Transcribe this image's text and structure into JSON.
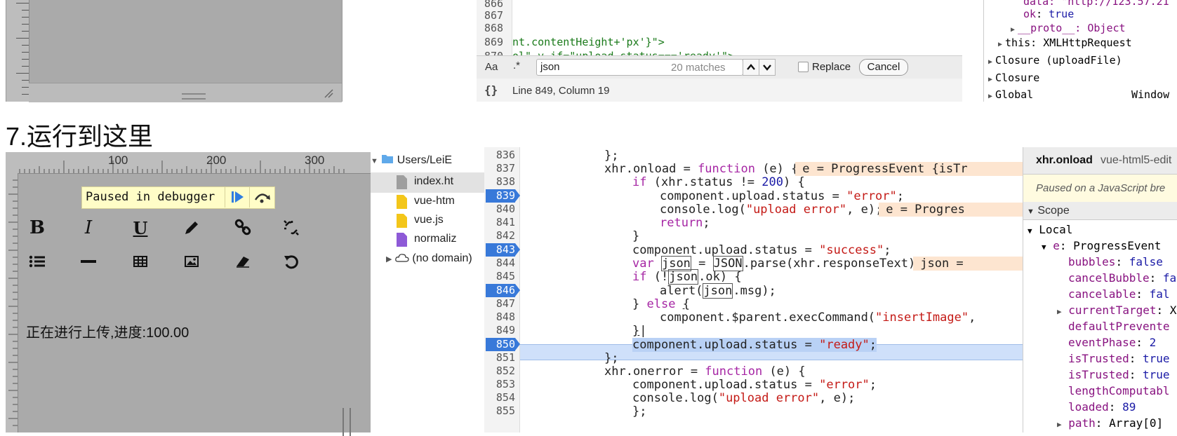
{
  "top_strip": {
    "code_line_numbers": [
      "866",
      "867",
      "868",
      "869",
      "870"
    ],
    "code_line_869": "nt.contentHeight+'px'}\">",
    "code_line_870_partial": "ol\" v-if=\"upload.status==='ready'\">",
    "find_bar": {
      "case_toggle": "Aa",
      "regex_toggle": ".*",
      "query": "json",
      "matches": "20 matches",
      "replace_label": "Replace",
      "cancel_label": "Cancel"
    },
    "status": {
      "braces": "{}",
      "position": "Line 849, Column 19"
    },
    "scope": {
      "data_line": "data: \"http://123.57.21",
      "ok_key": "ok",
      "ok_value": "true",
      "proto": "__proto__: Object",
      "this": "this: XMLHttpRequest",
      "closure_upload": "Closure (uploadFile)",
      "closure": "Closure",
      "global": "Global",
      "global_value": "Window"
    }
  },
  "heading": "7.运行到这里",
  "editor": {
    "ruler_labels": [
      "100",
      "200",
      "300"
    ],
    "paused_label": "Paused in debugger",
    "upload_status_text": "正在进行上传,进度:100.00",
    "toolbar_row1": [
      "bold-icon",
      "italic-icon",
      "underline-icon",
      "pencil-icon",
      "link-icon",
      "unlink-icon"
    ],
    "toolbar_row2": [
      "list-icon",
      "hr-icon",
      "table-icon",
      "image-icon",
      "eraser-icon",
      "undo-icon"
    ]
  },
  "sources": {
    "folder": "Users/LeiE",
    "files": [
      "index.ht",
      "vue-htm",
      "vue.js",
      "normaliz"
    ],
    "no_domain": "(no domain)"
  },
  "code": {
    "line_numbers": [
      "836",
      "837",
      "838",
      "839",
      "840",
      "841",
      "842",
      "843",
      "844",
      "845",
      "846",
      "847",
      "848",
      "849",
      "850",
      "851",
      "852",
      "853",
      "854",
      "855"
    ],
    "breakpoints": [
      "839",
      "843",
      "846",
      "850"
    ],
    "current_line": "850"
  },
  "scope_panel": {
    "header_title": "xhr.onload",
    "header_file": "vue-html5-edit",
    "paused_msg": "Paused on a JavaScript bre",
    "scope_title": "Scope",
    "local": "Local",
    "event_key": "e",
    "event_value": "ProgressEvent",
    "props": [
      {
        "k": "bubbles",
        "v": "false",
        "expand": false
      },
      {
        "k": "cancelBubble",
        "v": "fa",
        "expand": false
      },
      {
        "k": "cancelable",
        "v": "fal",
        "expand": false
      },
      {
        "k": "currentTarget",
        "v": "X",
        "expand": true
      },
      {
        "k": "defaultPrevente",
        "v": "",
        "expand": false
      },
      {
        "k": "eventPhase",
        "v": "2",
        "expand": false
      },
      {
        "k": "isTrusted",
        "v": "true",
        "expand": false
      },
      {
        "k": "isTrusted",
        "v": "true",
        "expand": false
      },
      {
        "k": "lengthComputabl",
        "v": "",
        "expand": false
      },
      {
        "k": "loaded",
        "v": "89",
        "expand": false
      },
      {
        "k": "path",
        "v": "Array[0]",
        "expand": true
      }
    ]
  }
}
